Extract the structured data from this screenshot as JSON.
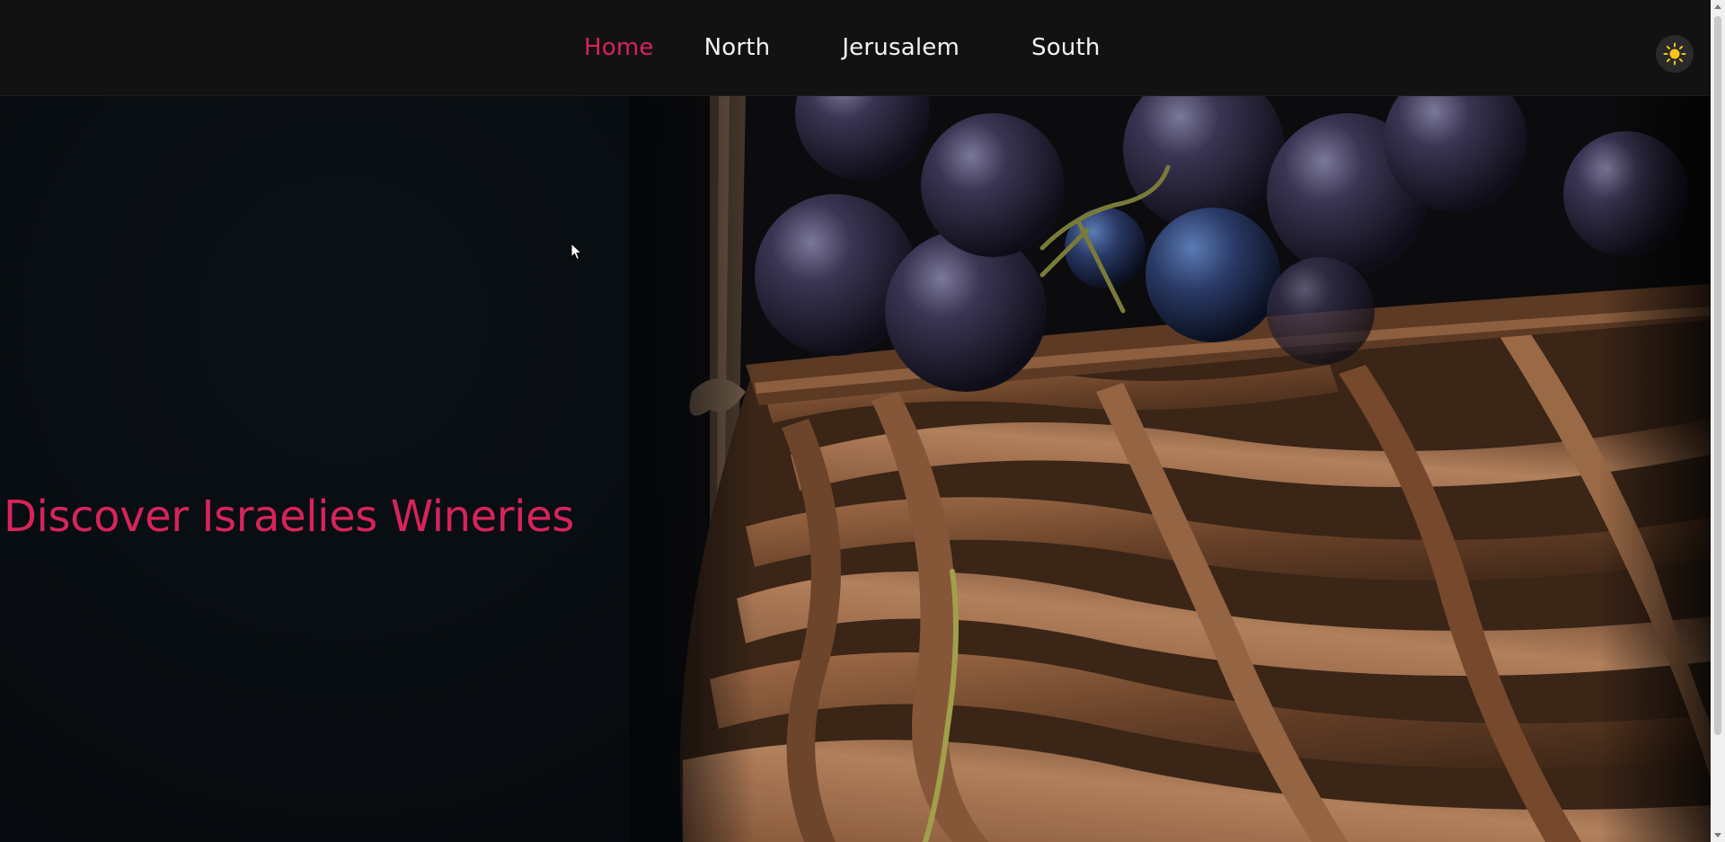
{
  "nav": {
    "items": [
      {
        "label": "Home",
        "active": true
      },
      {
        "label": "North",
        "active": false
      },
      {
        "label": "Jerusalem",
        "active": false
      },
      {
        "label": "South",
        "active": false
      }
    ],
    "theme_toggle_icon": "sun-icon"
  },
  "hero": {
    "title": "Discover Israelies Wineries",
    "image": "grapes-in-wicker-basket"
  },
  "colors": {
    "accent": "#d6245a",
    "nav_background": "#121212",
    "sun_icon": "#f5c518"
  }
}
